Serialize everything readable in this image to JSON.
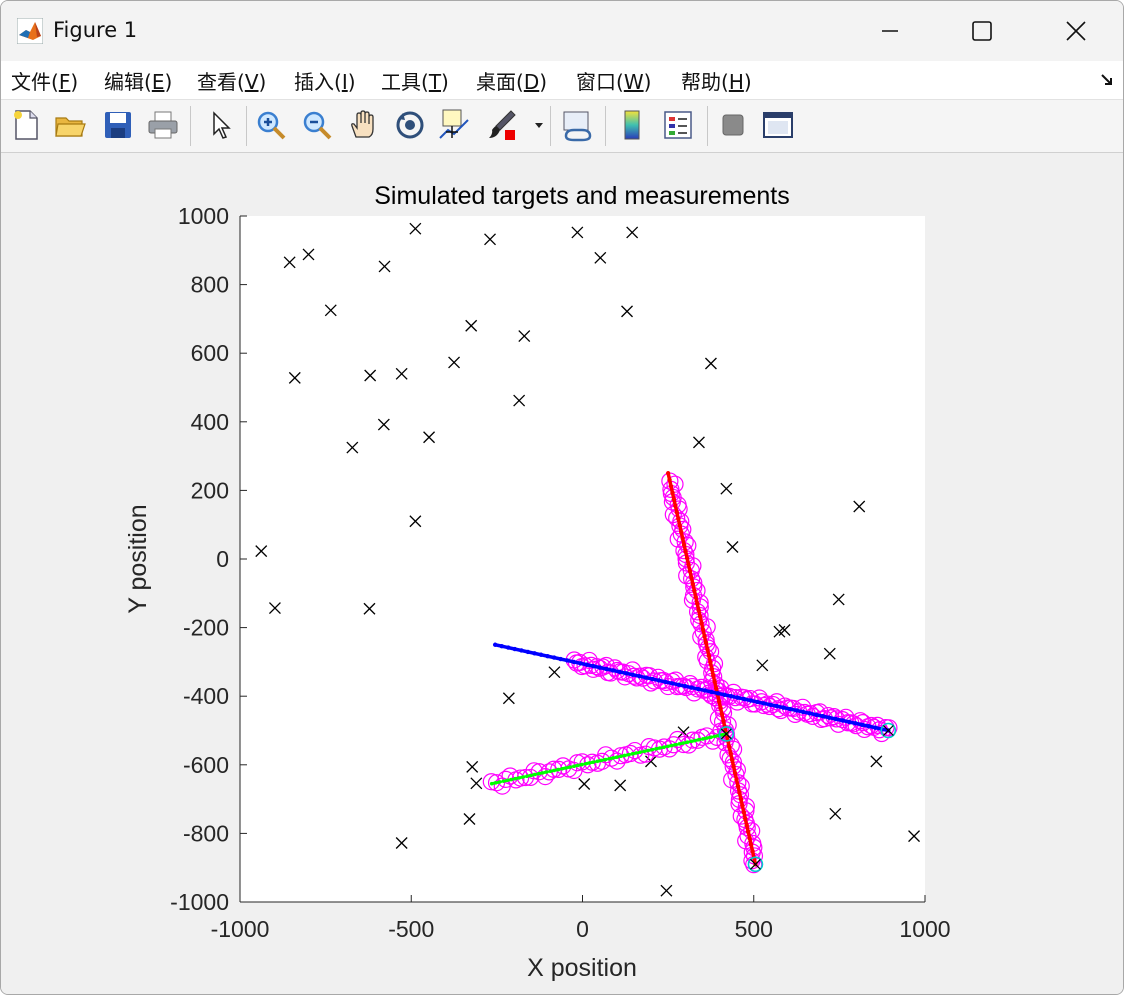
{
  "window": {
    "title": "Figure 1"
  },
  "menu": [
    {
      "pre": "文件(",
      "acc": "F",
      "post": ")"
    },
    {
      "pre": "编辑(",
      "acc": "E",
      "post": ")"
    },
    {
      "pre": "查看(",
      "acc": "V",
      "post": ")"
    },
    {
      "pre": "插入(",
      "acc": "I",
      "post": ")"
    },
    {
      "pre": "工具(",
      "acc": "T",
      "post": ")"
    },
    {
      "pre": "桌面(",
      "acc": "D",
      "post": ")"
    },
    {
      "pre": "窗口(",
      "acc": "W",
      "post": ")"
    },
    {
      "pre": "帮助(",
      "acc": "H",
      "post": ")"
    }
  ],
  "colors": {
    "red_track": "#ff0000",
    "blue_track": "#0000ff",
    "green_track": "#00ff00",
    "measurement_circle": "#ff00ff",
    "clutter_marker": "#000000",
    "endpoint_marker": "#00cccc"
  },
  "chart_data": {
    "type": "scatter",
    "title": "Simulated targets and measurements",
    "xlabel": "X position",
    "ylabel": "Y position",
    "xlim": [
      -1000,
      1000
    ],
    "ylim": [
      -1000,
      1000
    ],
    "xticks": [
      "-1000",
      "-500",
      "0",
      "500",
      "1000"
    ],
    "yticks": [
      "1000",
      "800",
      "600",
      "400",
      "200",
      "0",
      "-200",
      "-400",
      "-600",
      "-800",
      "-1000"
    ],
    "grid": false,
    "tracks": [
      {
        "color": "red",
        "start": [
          250,
          250
        ],
        "end": [
          505,
          -890
        ]
      },
      {
        "color": "blue",
        "start": [
          -255,
          -250
        ],
        "end": [
          893,
          -500
        ]
      },
      {
        "color": "green",
        "start": [
          -265,
          -655
        ],
        "end": [
          420,
          -510
        ]
      }
    ],
    "clutter": [
      [
        -938,
        23
      ],
      [
        -898,
        -143
      ],
      [
        -855,
        865
      ],
      [
        -840,
        528
      ],
      [
        -800,
        888
      ],
      [
        -735,
        725
      ],
      [
        -672,
        325
      ],
      [
        -620,
        535
      ],
      [
        -622,
        -145
      ],
      [
        -580,
        392
      ],
      [
        -578,
        853
      ],
      [
        -528,
        540
      ],
      [
        -528,
        -828
      ],
      [
        -488,
        963
      ],
      [
        -488,
        110
      ],
      [
        -448,
        355
      ],
      [
        -375,
        573
      ],
      [
        -330,
        -758
      ],
      [
        -325,
        680
      ],
      [
        -322,
        -606
      ],
      [
        -310,
        -654
      ],
      [
        -270,
        932
      ],
      [
        -215,
        -406
      ],
      [
        -185,
        462
      ],
      [
        -170,
        650
      ],
      [
        -82,
        -330
      ],
      [
        -15,
        952
      ],
      [
        5,
        -656
      ],
      [
        52,
        878
      ],
      [
        110,
        -660
      ],
      [
        130,
        722
      ],
      [
        145,
        952
      ],
      [
        200,
        -590
      ],
      [
        245,
        -967
      ],
      [
        295,
        -505
      ],
      [
        340,
        340
      ],
      [
        375,
        570
      ],
      [
        420,
        205
      ],
      [
        438,
        35
      ],
      [
        525,
        -310
      ],
      [
        575,
        -212
      ],
      [
        590,
        -207
      ],
      [
        722,
        -276
      ],
      [
        738,
        -743
      ],
      [
        748,
        -118
      ],
      [
        808,
        153
      ],
      [
        858,
        -590
      ],
      [
        968,
        -808
      ]
    ]
  }
}
